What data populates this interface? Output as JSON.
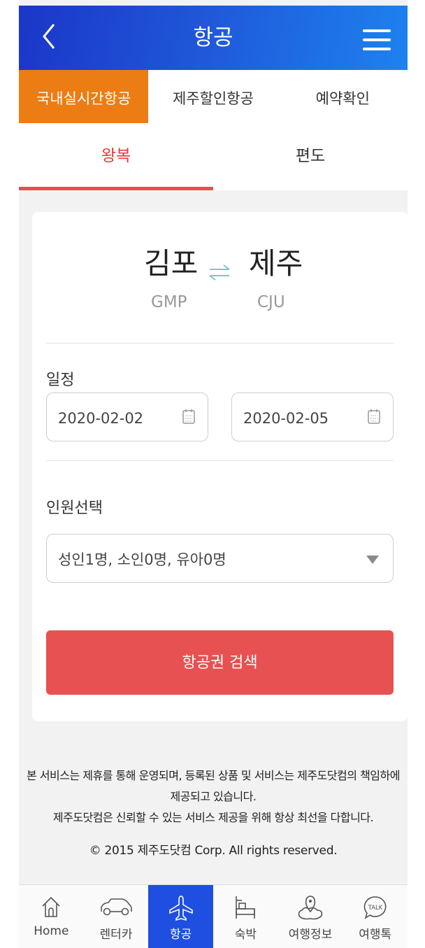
{
  "header": {
    "title": "항공"
  },
  "tabs": [
    {
      "label": "국내실시간항공",
      "active": true
    },
    {
      "label": "제주할인항공",
      "active": false
    },
    {
      "label": "예약확인",
      "active": false
    }
  ],
  "trip_types": [
    {
      "label": "왕복",
      "active": true
    },
    {
      "label": "편도",
      "active": false
    }
  ],
  "route": {
    "from_city": "김포",
    "from_code": "GMP",
    "to_city": "제주",
    "to_code": "CJU"
  },
  "schedule": {
    "label": "일정",
    "depart_date": "2020-02-02",
    "return_date": "2020-02-05"
  },
  "passengers": {
    "label": "인원선택",
    "value": "성인1명, 소인0명, 유아0명"
  },
  "search_button": "항공권 검색",
  "footer": {
    "line1": "본 서비스는 제휴를 통해 운영되며, 등록된 상품 및 서비스는 제주도닷컴의 책임하에",
    "line2": "제공되고 있습니다.",
    "line3": "제주도닷컴은 신뢰할 수 있는 서비스 제공을 위해 항상 최선을 다합니다.",
    "copyright": "© 2015 제주도닷컴 Corp. All rights reserved."
  },
  "bottom_nav": [
    {
      "label": "Home",
      "icon": "home-icon",
      "active": false
    },
    {
      "label": "렌터카",
      "icon": "car-icon",
      "active": false
    },
    {
      "label": "항공",
      "icon": "airplane-icon",
      "active": true
    },
    {
      "label": "숙박",
      "icon": "bed-icon",
      "active": false
    },
    {
      "label": "여행정보",
      "icon": "map-pin-icon",
      "active": false
    },
    {
      "label": "여행톡",
      "icon": "talk-bubble-icon",
      "active": false
    }
  ],
  "colors": {
    "header_gradient_start": "#1b36c8",
    "header_gradient_end": "#1e82ef",
    "active_tab": "#ec7d14",
    "accent_red": "#e85151",
    "nav_active": "#1f4fe0"
  }
}
